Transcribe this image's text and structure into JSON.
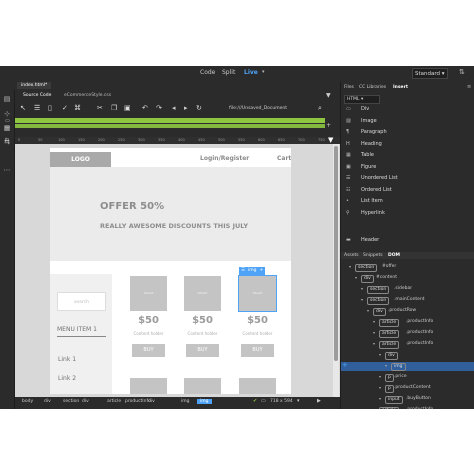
{
  "topbar": {
    "views": [
      "Code",
      "Split",
      "Live"
    ],
    "active_view": "Live",
    "workspace": "Standard"
  },
  "files": {
    "tab": "index.html*",
    "related": [
      "Source Code",
      "eCommerceStyle.css"
    ]
  },
  "url": "file:///Unsaved_Document",
  "ruler_ticks": [
    "0",
    "50",
    "100",
    "150",
    "200",
    "250",
    "300",
    "350",
    "400",
    "450",
    "500",
    "550",
    "600",
    "650",
    "700",
    "750"
  ],
  "page": {
    "logo": "LOGO",
    "nav": [
      "Login/Register",
      "Cart"
    ],
    "hero_title": "OFFER 50%",
    "hero_sub": "REALLY AWESOME DISCOUNTS THIS JULY",
    "search_placeholder": "search",
    "menu_title": "MENU ITEM 1",
    "links": [
      "Link 1",
      "Link 2"
    ],
    "products": [
      {
        "img": "IMAGE",
        "price": "$50",
        "holder": "Content holder",
        "buy": "BUY"
      },
      {
        "img": "IMAGE",
        "price": "$50",
        "holder": "Content holder",
        "buy": "BUY"
      },
      {
        "img": "IMAGE",
        "price": "$50",
        "holder": "Content holder",
        "buy": "BUY"
      }
    ],
    "selected_tag": "img"
  },
  "status": {
    "breadcrumbs": [
      "body",
      "div",
      "section",
      "div",
      "article",
      "productInfo",
      "div",
      "img"
    ],
    "active": "img",
    "size": "718 x 594"
  },
  "right": {
    "tabs": [
      "Files",
      "CC Libraries",
      "Insert"
    ],
    "active_tab": "Insert",
    "insert_category": "HTML",
    "insert_items": [
      "Div",
      "Image",
      "Paragraph",
      "Heading",
      "Table",
      "Figure",
      "Unordered List",
      "Ordered List",
      "List Item",
      "Hyperlink",
      "Header"
    ],
    "lower_tabs": [
      "Assets",
      "Snippets",
      "DOM"
    ],
    "dom": [
      {
        "tag": "section",
        "label": "#offer"
      },
      {
        "tag": "div",
        "label": "#content"
      },
      {
        "tag": "section",
        "label": ".sidebar"
      },
      {
        "tag": "section",
        "label": ".mainContent"
      },
      {
        "tag": "div",
        "label": ".productRow"
      },
      {
        "tag": "article",
        "label": ".productInfo"
      },
      {
        "tag": "article",
        "label": ".productInfo"
      },
      {
        "tag": "article",
        "label": ".productInfo"
      },
      {
        "tag": "div",
        "label": ""
      },
      {
        "tag": "img",
        "label": ""
      },
      {
        "tag": "p",
        "label": ".price"
      },
      {
        "tag": "p",
        "label": ".productContent"
      },
      {
        "tag": "input",
        "label": ".buyButton"
      },
      {
        "tag": "article",
        "label": ".productInfo"
      }
    ]
  }
}
